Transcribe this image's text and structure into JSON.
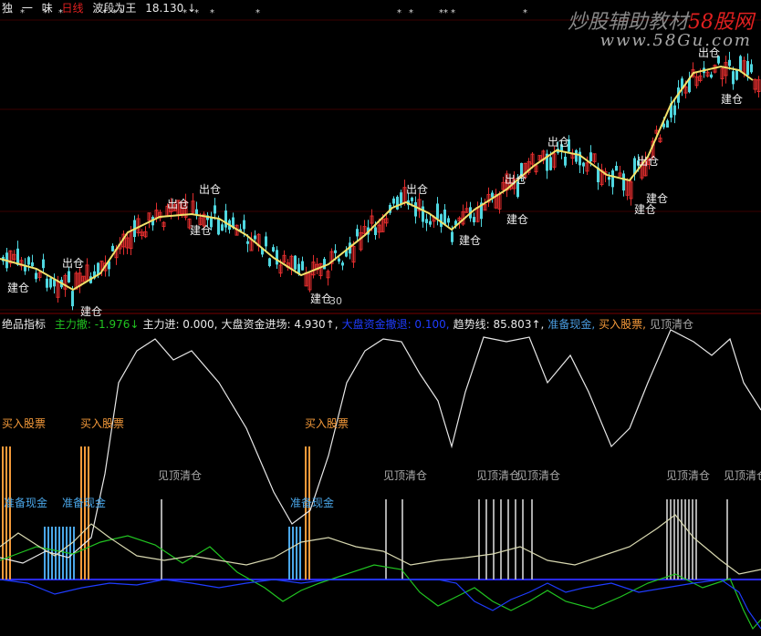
{
  "header_top": {
    "items": [
      "独",
      "一",
      "味",
      "日线",
      "波段为王",
      "18.130",
      "↓"
    ]
  },
  "header_mid": {
    "indicator_name": "绝品指标",
    "items": [
      {
        "label": "主力撤:",
        "value": "-1.976",
        "arrow": "↓",
        "color": "#21c421"
      },
      {
        "label": "主力进:",
        "value": "0.000,",
        "arrow": "",
        "color": "#e8e8e8"
      },
      {
        "label": "大盘资金进场:",
        "value": "4.930",
        "arrow": "↑,",
        "color": "#e8e8e8"
      },
      {
        "label": "大盘资金撤退:",
        "value": "0.100,",
        "arrow": "",
        "color": "#1f3cff"
      },
      {
        "label": "趋势线:",
        "value": "85.803",
        "arrow": "↑,",
        "color": "#e8e8e8"
      },
      {
        "label": "准备现金,",
        "value": "",
        "arrow": "",
        "color": "#4a9ce0"
      },
      {
        "label": "买入股票,",
        "value": "",
        "arrow": "",
        "color": "#f59a3a"
      },
      {
        "label": "见顶清仓",
        "value": "",
        "arrow": "",
        "color": "#aaaaaa"
      }
    ]
  },
  "watermark": {
    "line1_prefix": "炒股辅助教材",
    "line1_brand": "58股网",
    "line2": "www.58Gu.com"
  },
  "colors": {
    "up": "#e02d2d",
    "down": "#4fd7e0",
    "ma": "#f2e26a",
    "buy": "#f59a3a",
    "cash": "#4aa6e8",
    "top": "#aaaaaa",
    "trend": "#e8e8e8",
    "zero_line": "#2a2aff"
  },
  "chart_data": [
    {
      "type": "candlestick",
      "title": "",
      "price_label": "18.130",
      "low_label": "30",
      "ma_curve": [
        [
          0,
          284
        ],
        [
          40,
          295
        ],
        [
          80,
          318
        ],
        [
          110,
          300
        ],
        [
          140,
          255
        ],
        [
          175,
          238
        ],
        [
          210,
          235
        ],
        [
          240,
          240
        ],
        [
          270,
          258
        ],
        [
          300,
          283
        ],
        [
          330,
          302
        ],
        [
          360,
          290
        ],
        [
          400,
          258
        ],
        [
          430,
          228
        ],
        [
          445,
          222
        ],
        [
          470,
          234
        ],
        [
          495,
          252
        ],
        [
          520,
          230
        ],
        [
          555,
          208
        ],
        [
          585,
          182
        ],
        [
          610,
          165
        ],
        [
          635,
          170
        ],
        [
          665,
          192
        ],
        [
          690,
          198
        ],
        [
          710,
          172
        ],
        [
          735,
          115
        ],
        [
          760,
          80
        ],
        [
          790,
          73
        ],
        [
          810,
          77
        ],
        [
          825,
          88
        ]
      ],
      "annotations": [
        {
          "text": "出仓",
          "x": 68,
          "y": 293
        },
        {
          "text": "建仓",
          "x": 8,
          "y": 320
        },
        {
          "text": "建仓",
          "x": 88,
          "y": 346
        },
        {
          "text": "出仓",
          "x": 183,
          "y": 228
        },
        {
          "text": "出仓",
          "x": 218,
          "y": 212
        },
        {
          "text": "建仓",
          "x": 208,
          "y": 257
        },
        {
          "text": "建仓",
          "x": 340,
          "y": 332
        },
        {
          "text": "出仓",
          "x": 445,
          "y": 212
        },
        {
          "text": "建仓",
          "x": 503,
          "y": 268
        },
        {
          "text": "出仓",
          "x": 553,
          "y": 201
        },
        {
          "text": "建仓",
          "x": 555,
          "y": 245
        },
        {
          "text": "出仓",
          "x": 600,
          "y": 160
        },
        {
          "text": "出仓",
          "x": 698,
          "y": 181
        },
        {
          "text": "建仓",
          "x": 708,
          "y": 222
        },
        {
          "text": "建仓",
          "x": 695,
          "y": 234
        },
        {
          "text": "出仓",
          "x": 765,
          "y": 62
        },
        {
          "text": "建仓",
          "x": 790,
          "y": 113
        }
      ],
      "star_marks_x": [
        22,
        47,
        64,
        112,
        123,
        130,
        200,
        213,
        230,
        280,
        435,
        448,
        481,
        486,
        494,
        573
      ]
    },
    {
      "type": "line",
      "title": "",
      "series": [
        {
          "name": "趋势线",
          "color": "#e8e8e8",
          "points": [
            [
              0,
              612
            ],
            [
              25,
              618
            ],
            [
              50,
              605
            ],
            [
              75,
              612
            ],
            [
              100,
              590
            ],
            [
              115,
              520
            ],
            [
              130,
              420
            ],
            [
              150,
              385
            ],
            [
              170,
              372
            ],
            [
              190,
              395
            ],
            [
              210,
              385
            ],
            [
              240,
              420
            ],
            [
              270,
              470
            ],
            [
              300,
              540
            ],
            [
              320,
              575
            ],
            [
              340,
              560
            ],
            [
              360,
              500
            ],
            [
              380,
              420
            ],
            [
              400,
              385
            ],
            [
              420,
              372
            ],
            [
              440,
              375
            ],
            [
              460,
              410
            ],
            [
              480,
              440
            ],
            [
              495,
              490
            ],
            [
              510,
              430
            ],
            [
              530,
              370
            ],
            [
              555,
              375
            ],
            [
              580,
              370
            ],
            [
              600,
              420
            ],
            [
              625,
              390
            ],
            [
              645,
              430
            ],
            [
              670,
              490
            ],
            [
              690,
              470
            ],
            [
              710,
              420
            ],
            [
              735,
              362
            ],
            [
              760,
              375
            ],
            [
              780,
              390
            ],
            [
              800,
              372
            ],
            [
              815,
              420
            ],
            [
              834,
              450
            ]
          ]
        },
        {
          "name": "主力撤",
          "color": "#21c421",
          "points": [
            [
              0,
              615
            ],
            [
              40,
              600
            ],
            [
              80,
              608
            ],
            [
              110,
              595
            ],
            [
              140,
              588
            ],
            [
              170,
              598
            ],
            [
              200,
              618
            ],
            [
              230,
              600
            ],
            [
              260,
              628
            ],
            [
              290,
              645
            ],
            [
              310,
              660
            ],
            [
              330,
              648
            ],
            [
              350,
              640
            ],
            [
              380,
              630
            ],
            [
              410,
              620
            ],
            [
              440,
              625
            ],
            [
              460,
              650
            ],
            [
              480,
              665
            ],
            [
              500,
              655
            ],
            [
              520,
              645
            ],
            [
              540,
              660
            ],
            [
              560,
              670
            ],
            [
              580,
              660
            ],
            [
              600,
              648
            ],
            [
              620,
              660
            ],
            [
              650,
              668
            ],
            [
              680,
              655
            ],
            [
              710,
              640
            ],
            [
              740,
              630
            ],
            [
              770,
              645
            ],
            [
              800,
              635
            ],
            [
              815,
              670
            ],
            [
              825,
              690
            ],
            [
              834,
              680
            ]
          ]
        },
        {
          "name": "大盘资金撤退",
          "color": "#1f3cff",
          "points": [
            [
              0,
              636
            ],
            [
              30,
              640
            ],
            [
              60,
              652
            ],
            [
              90,
              645
            ],
            [
              120,
              640
            ],
            [
              150,
              642
            ],
            [
              180,
              636
            ],
            [
              210,
              640
            ],
            [
              240,
              645
            ],
            [
              270,
              640
            ],
            [
              300,
              636
            ],
            [
              330,
              640
            ],
            [
              360,
              636
            ],
            [
              390,
              636
            ],
            [
              420,
              636
            ],
            [
              450,
              636
            ],
            [
              480,
              636
            ],
            [
              500,
              640
            ],
            [
              520,
              660
            ],
            [
              540,
              670
            ],
            [
              560,
              658
            ],
            [
              580,
              650
            ],
            [
              600,
              640
            ],
            [
              620,
              650
            ],
            [
              640,
              645
            ],
            [
              670,
              640
            ],
            [
              700,
              650
            ],
            [
              730,
              645
            ],
            [
              760,
              640
            ],
            [
              790,
              636
            ],
            [
              810,
              650
            ],
            [
              820,
              670
            ],
            [
              834,
              690
            ]
          ]
        },
        {
          "name": "大盘资金进场",
          "color": "#d8d8b0",
          "points": [
            [
              0,
              600
            ],
            [
              20,
              585
            ],
            [
              40,
              598
            ],
            [
              60,
              610
            ],
            [
              80,
              595
            ],
            [
              100,
              575
            ],
            [
              120,
              590
            ],
            [
              150,
              610
            ],
            [
              180,
              615
            ],
            [
              210,
              610
            ],
            [
              240,
              615
            ],
            [
              270,
              620
            ],
            [
              300,
              612
            ],
            [
              330,
              595
            ],
            [
              360,
              590
            ],
            [
              390,
              600
            ],
            [
              420,
              605
            ],
            [
              450,
              620
            ],
            [
              480,
              615
            ],
            [
              510,
              612
            ],
            [
              540,
              608
            ],
            [
              570,
              600
            ],
            [
              600,
              615
            ],
            [
              630,
              620
            ],
            [
              660,
              610
            ],
            [
              690,
              600
            ],
            [
              720,
              580
            ],
            [
              740,
              565
            ],
            [
              760,
              590
            ],
            [
              790,
              615
            ],
            [
              810,
              630
            ],
            [
              834,
              625
            ]
          ]
        }
      ],
      "labels": [
        {
          "text": "买入股票",
          "color": "#f59a3a",
          "x": 2,
          "y": 469
        },
        {
          "text": "买入股票",
          "color": "#f59a3a",
          "x": 88,
          "y": 469
        },
        {
          "text": "买入股票",
          "color": "#f59a3a",
          "x": 334,
          "y": 469
        },
        {
          "text": "准备现金",
          "color": "#4aa6e8",
          "x": 4,
          "y": 556
        },
        {
          "text": "准备现金",
          "color": "#4aa6e8",
          "x": 68,
          "y": 556
        },
        {
          "text": "准备现金",
          "color": "#4aa6e8",
          "x": 318,
          "y": 556
        },
        {
          "text": "见顶清仓",
          "color": "#aaaaaa",
          "x": 173,
          "y": 526
        },
        {
          "text": "见顶清仓",
          "color": "#aaaaaa",
          "x": 420,
          "y": 526
        },
        {
          "text": "见顶清仓",
          "color": "#aaaaaa",
          "x": 522,
          "y": 526
        },
        {
          "text": "见顶清仓",
          "color": "#aaaaaa",
          "x": 566,
          "y": 526
        },
        {
          "text": "见顶清仓",
          "color": "#aaaaaa",
          "x": 730,
          "y": 526
        },
        {
          "text": "见顶清仓",
          "color": "#aaaaaa",
          "x": 793,
          "y": 526
        }
      ]
    }
  ]
}
